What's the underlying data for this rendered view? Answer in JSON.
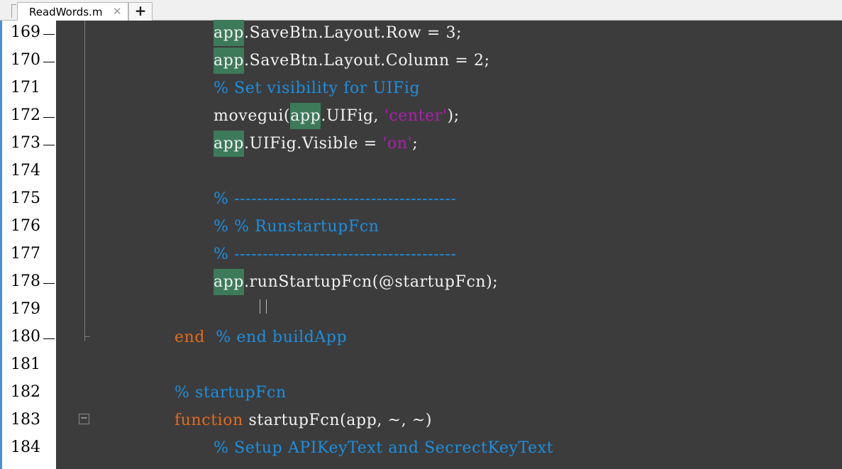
{
  "tabs": [
    {
      "label": "ReadWords.m",
      "close": "✕"
    }
  ],
  "add_tab_label": "+",
  "lines": [
    {
      "num": "169",
      "mark": true,
      "indent": 298,
      "parts": [
        {
          "t": "app",
          "c": "hl"
        },
        {
          "t": ".SaveBtn.Layout.Row = 3;",
          "c": ""
        }
      ]
    },
    {
      "num": "170",
      "mark": true,
      "indent": 298,
      "parts": [
        {
          "t": "app",
          "c": "hl"
        },
        {
          "t": ".SaveBtn.Layout.Column = 2;",
          "c": ""
        }
      ]
    },
    {
      "num": "171",
      "mark": false,
      "indent": 298,
      "parts": [
        {
          "t": "% Set visibility for UIFig",
          "c": "cm"
        }
      ]
    },
    {
      "num": "172",
      "mark": true,
      "indent": 298,
      "parts": [
        {
          "t": "movegui(",
          "c": ""
        },
        {
          "t": "app",
          "c": "hl"
        },
        {
          "t": ".UIFig, ",
          "c": ""
        },
        {
          "t": "'center'",
          "c": "str"
        },
        {
          "t": ");",
          "c": ""
        }
      ]
    },
    {
      "num": "173",
      "mark": true,
      "indent": 298,
      "parts": [
        {
          "t": "app",
          "c": "hl"
        },
        {
          "t": ".UIFig.Visible = ",
          "c": ""
        },
        {
          "t": "'on'",
          "c": "str"
        },
        {
          "t": ";",
          "c": ""
        }
      ]
    },
    {
      "num": "174",
      "mark": false,
      "indent": 298,
      "parts": []
    },
    {
      "num": "175",
      "mark": false,
      "indent": 298,
      "parts": [
        {
          "t": "% ---------------------------------------",
          "c": "cm"
        }
      ]
    },
    {
      "num": "176",
      "mark": false,
      "indent": 298,
      "parts": [
        {
          "t": "% % RunstartupFcn",
          "c": "cm"
        }
      ]
    },
    {
      "num": "177",
      "mark": false,
      "indent": 298,
      "parts": [
        {
          "t": "% ---------------------------------------",
          "c": "cm"
        }
      ]
    },
    {
      "num": "178",
      "mark": true,
      "indent": 298,
      "parts": [
        {
          "t": "app",
          "c": "hl"
        },
        {
          "t": ".runStartupFcn(@startupFcn);",
          "c": ""
        }
      ]
    },
    {
      "num": "179",
      "mark": false,
      "indent": 298,
      "parts": []
    },
    {
      "num": "180",
      "mark": true,
      "indent": 243,
      "parts": [
        {
          "t": "end",
          "c": "kw"
        },
        {
          "t": "  ",
          "c": ""
        },
        {
          "t": "% end buildApp",
          "c": "cm"
        }
      ]
    },
    {
      "num": "181",
      "mark": false,
      "indent": 243,
      "parts": []
    },
    {
      "num": "182",
      "mark": false,
      "indent": 243,
      "parts": [
        {
          "t": "% startupFcn",
          "c": "cm"
        }
      ]
    },
    {
      "num": "183",
      "mark": false,
      "indent": 243,
      "parts": [
        {
          "t": "function",
          "c": "kw"
        },
        {
          "t": " startupFcn(app, ~, ~)",
          "c": ""
        }
      ]
    },
    {
      "num": "184",
      "mark": false,
      "indent": 298,
      "parts": [
        {
          "t": "% Setup APIKeyText and SecrectKeyText",
          "c": "cm"
        }
      ]
    }
  ],
  "fold_box_label": "−"
}
